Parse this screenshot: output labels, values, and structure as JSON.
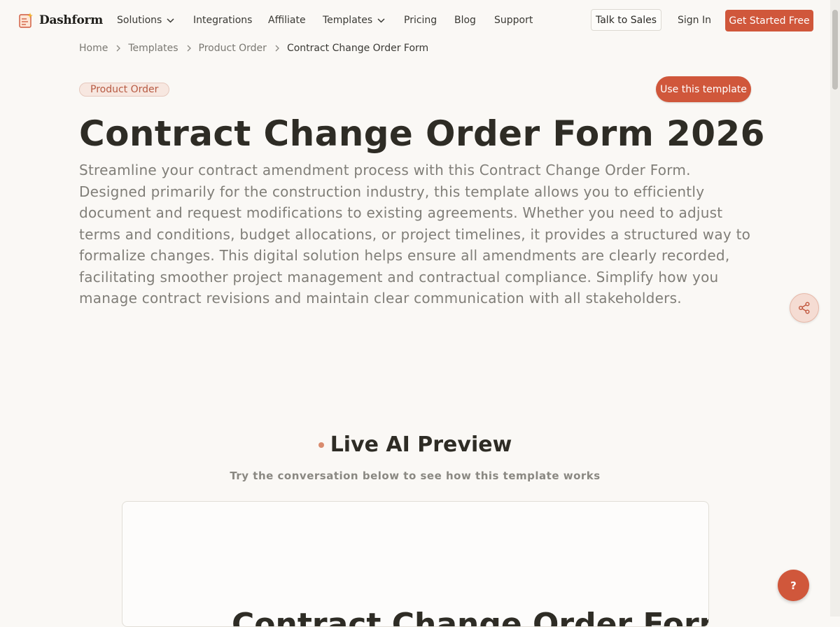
{
  "header": {
    "logo_text": "Dashform",
    "nav": [
      {
        "label": "Solutions",
        "has_dropdown": true
      },
      {
        "label": "Integrations",
        "has_dropdown": false
      },
      {
        "label": "Affiliate",
        "has_dropdown": false
      },
      {
        "label": "Templates",
        "has_dropdown": true
      },
      {
        "label": "Pricing",
        "has_dropdown": false
      },
      {
        "label": "Blog",
        "has_dropdown": false
      },
      {
        "label": "Support",
        "has_dropdown": false
      }
    ],
    "talk_to_sales": "Talk to Sales",
    "sign_in": "Sign In",
    "get_started": "Get Started Free"
  },
  "breadcrumb": [
    "Home",
    "Templates",
    "Product Order",
    "Contract Change Order Form"
  ],
  "tag": "Product Order",
  "use_template": "Use this template",
  "title": "Contract Change Order Form 2026",
  "description": "Streamline your contract amendment process with this Contract Change Order Form. Designed primarily for the construction industry, this template allows you to efficiently document and request modifications to existing agreements. Whether you need to adjust terms and conditions, budget allocations, or project timelines, it provides a structured way to formalize changes. This digital solution helps ensure all amendments are clearly recorded, facilitating smoother project management and contractual compliance. Simplify how you manage contract revisions and maintain clear communication with all stakeholders.",
  "preview": {
    "title": "Live AI Preview",
    "subtitle": "Try the conversation below to see how this template works",
    "form_title": "Contract Change Order Form"
  },
  "help_button": "?",
  "colors": {
    "accent": "#d0573b",
    "background": "#faf8f5",
    "tag_bg": "#f7e7e0"
  }
}
